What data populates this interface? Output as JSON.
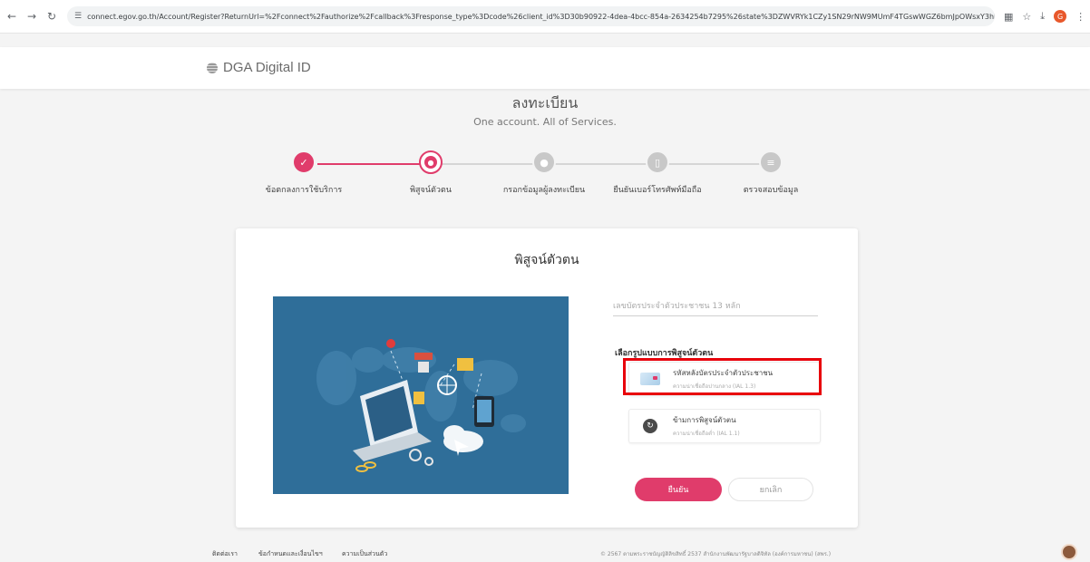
{
  "browser": {
    "url": "connect.egov.go.th/Account/Register?ReturnUrl=%2Fconnect%2Fauthorize%2Fcallback%3Fresponse_type%3Dcode%26client_id%3D30b90922-4dea-4bcc-854a-2634254b7295%26state%3DZWVRYk1CZy1SN29rNW9MUmF4TGswWGZ6bmJpOWsxY3hkb...",
    "profile_initial": "G"
  },
  "header": {
    "logo_text": "DGA Digital ID"
  },
  "page": {
    "title": "ลงทะเบียน",
    "subtitle": "One account. All of Services."
  },
  "steps": [
    {
      "label": "ข้อตกลงการใช้บริการ",
      "state": "done"
    },
    {
      "label": "พิสูจน์ตัวตน",
      "state": "current"
    },
    {
      "label": "กรอกข้อมูลผู้ลงทะเบียน",
      "state": "pending"
    },
    {
      "label": "ยืนยันเบอร์โทรศัพท์มือถือ",
      "state": "pending"
    },
    {
      "label": "ตรวจสอบข้อมูล",
      "state": "pending"
    }
  ],
  "card": {
    "title": "พิสูจน์ตัวตน",
    "id_placeholder": "เลขบัตรประจำตัวประชาชน 13 หลัก",
    "choose_label": "เลือกรูปแบบการพิสูจน์ตัวตน",
    "options": [
      {
        "label": "รหัสหลังบัตรประจำตัวประชาชน",
        "sublabel": "ความน่าเชื่อถือปานกลาง (IAL 1.3)",
        "icon": "id-card-icon"
      },
      {
        "label": "ข้ามการพิสูจน์ตัวตน",
        "sublabel": "ความน่าเชื่อถือต่ำ (IAL 1.1)",
        "icon": "skip-icon"
      }
    ],
    "confirm_label": "ยืนยัน",
    "cancel_label": "ยกเลิก"
  },
  "footer": {
    "links": [
      "ติดต่อเรา",
      "ข้อกำหนดและเงื่อนไขฯ",
      "ความเป็นส่วนตัว"
    ],
    "copyright": "© 2567 ตามพระราชบัญญัติลิขสิทธิ์ 2537 สำนักงานพัฒนารัฐบาลดิจิทัล (องค์การมหาชน) (สพร.)"
  },
  "colors": {
    "accent": "#e03c6b",
    "highlight": "#e8000b",
    "illustration_bg": "#2f6e99"
  }
}
